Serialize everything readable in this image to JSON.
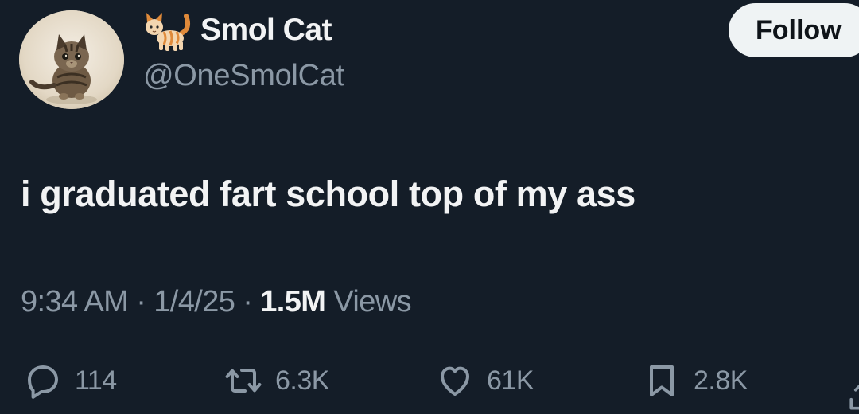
{
  "author": {
    "display_name": "Smol Cat",
    "handle": "@OneSmolCat",
    "name_emoji_icon": "cat-emoji-icon",
    "avatar_icon": "kitten-photo"
  },
  "follow": {
    "label": "Follow"
  },
  "tweet": {
    "text": "i graduated fart school top of my ass"
  },
  "meta": {
    "time": "9:34 AM",
    "separator": " · ",
    "date": "1/4/25",
    "views_count": "1.5M",
    "views_label": " Views"
  },
  "actions": {
    "reply": {
      "icon": "reply-icon",
      "count": "114"
    },
    "retweet": {
      "icon": "retweet-icon",
      "count": "6.3K"
    },
    "like": {
      "icon": "heart-icon",
      "count": "61K"
    },
    "bookmark": {
      "icon": "bookmark-icon",
      "count": "2.8K"
    },
    "share": {
      "icon": "share-icon"
    }
  },
  "colors": {
    "background": "#141d28",
    "primary_text": "#f2f3f4",
    "secondary_text": "#8b98a5",
    "follow_button_bg": "#eff3f4",
    "follow_button_text": "#0f1419"
  }
}
